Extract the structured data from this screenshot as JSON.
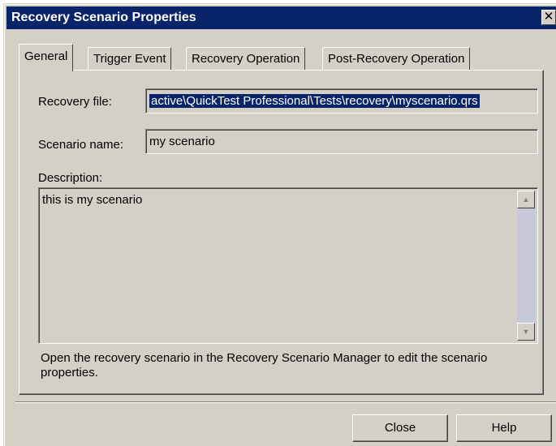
{
  "window": {
    "title": "Recovery Scenario Properties",
    "close_glyph": "✕"
  },
  "tabs": [
    {
      "label": "General",
      "active": true
    },
    {
      "label": "Trigger Event",
      "active": false
    },
    {
      "label": "Recovery Operation",
      "active": false
    },
    {
      "label": "Post-Recovery Operation",
      "active": false
    }
  ],
  "general": {
    "recovery_file_label": "Recovery file:",
    "recovery_file_value": "active\\QuickTest Professional\\Tests\\recovery\\myscenario.qrs",
    "scenario_name_label": "Scenario name:",
    "scenario_name_value": "my scenario",
    "description_label": "Description:",
    "description_value": "this is my scenario",
    "info_text": "Open the recovery scenario in the Recovery Scenario Manager to edit the scenario properties."
  },
  "buttons": {
    "close_label": "Close",
    "help_label": "Help"
  },
  "icons": {
    "scroll_up": "scroll-up-arrow-icon",
    "scroll_down": "scroll-down-arrow-icon",
    "close": "close-icon"
  },
  "colors": {
    "titlebar": "#0a246a",
    "face": "#d4d0c8",
    "selection": "#0a246a"
  }
}
